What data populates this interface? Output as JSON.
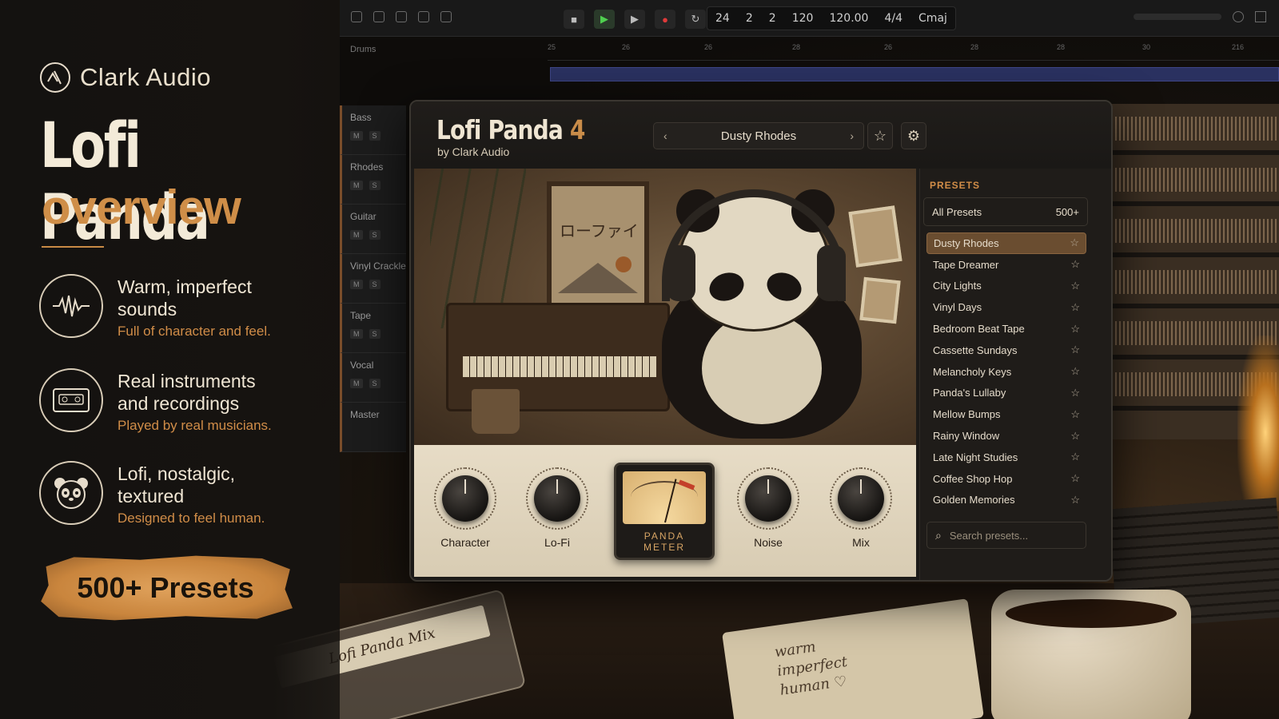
{
  "promo": {
    "brand": "Clark Audio",
    "title": "Lofi Panda",
    "subtitle": "overview",
    "features": [
      {
        "icon": "waveform-icon",
        "title": "Warm, imperfect sounds",
        "sub": "Full of character and feel."
      },
      {
        "icon": "cassette-icon",
        "title": "Real instruments and recordings",
        "sub": "Played by real musicians."
      },
      {
        "icon": "panda-icon",
        "title": "Lofi, nostalgic, textured",
        "sub": "Designed to feel human."
      }
    ],
    "badge": "500+ Presets"
  },
  "daw": {
    "lcd": [
      "24",
      "2",
      "2",
      "120",
      "120.00",
      "4/4",
      "Cmaj"
    ],
    "drums_track": "Drums",
    "tracks": [
      "Bass",
      "Rhodes",
      "Guitar",
      "Vinyl Crackle",
      "Tape",
      "Vocal",
      "Master"
    ],
    "ruler": [
      "25",
      "26",
      "26",
      "28",
      "26",
      "28",
      "28",
      "30",
      "216"
    ],
    "track_color": "#7a4d2a"
  },
  "plugin": {
    "name": "Lofi Panda",
    "version": "4",
    "by": "by Clark Audio",
    "current_preset": "Dusty Rhodes",
    "artwork_text": "ローファイ",
    "knobs": [
      {
        "label": "Character",
        "value": 0.5
      },
      {
        "label": "Lo-Fi",
        "value": 0.5
      },
      {
        "label": "Noise",
        "value": 0.5
      },
      {
        "label": "Mix",
        "value": 0.5
      }
    ],
    "meter_label_1": "PANDA",
    "meter_label_2": "METER",
    "accent": "#c98c49"
  },
  "presets_panel": {
    "heading": "PRESETS",
    "all_label": "All Presets",
    "all_count": "500+",
    "items": [
      "Dusty Rhodes",
      "Tape Dreamer",
      "City Lights",
      "Vinyl Days",
      "Bedroom Beat Tape",
      "Cassette Sundays",
      "Melancholy Keys",
      "Panda's Lullaby",
      "Mellow Bumps",
      "Rainy Window",
      "Late Night Studies",
      "Coffee Shop Hop",
      "Golden Memories"
    ],
    "active_index": 0,
    "search_placeholder": "Search presets..."
  },
  "props": {
    "cassette_label": "Lofi Panda Mix",
    "notebook_text": "warm imperfect human ♡"
  }
}
